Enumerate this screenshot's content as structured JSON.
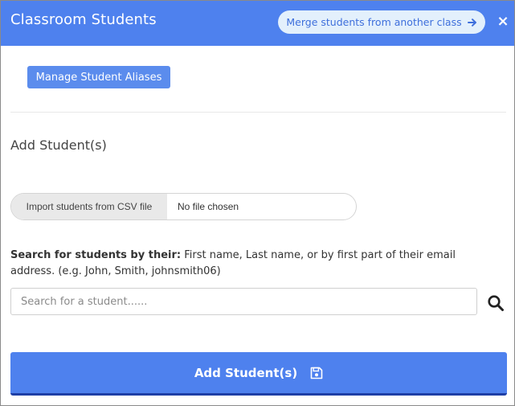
{
  "header": {
    "title": "Classroom Students",
    "merge_label": "Merge students from another class",
    "close_glyph": "×"
  },
  "aliases": {
    "button_label": "Manage Student Aliases"
  },
  "add_section": {
    "title": "Add Student(s)",
    "file_button_label": "Import students from CSV file",
    "file_status": "No file chosen",
    "search_prefix": "Search for students by their:",
    "search_hint": " First name, Last name, or by first part of their email address. (e.g. John, Smith, johnsmith06)",
    "search_placeholder": "Search for a student......",
    "search_value": "",
    "submit_label": "Add Student(s)"
  },
  "icons": {
    "merge_arrow": "arrow-right-icon",
    "close": "close-icon",
    "search": "search-icon",
    "submit": "save-icon"
  },
  "colors": {
    "header": "#4e81ee",
    "accent": "#4e81ee",
    "accent_dark": "#1f3fa6",
    "merge_pill": "#e3f0fc",
    "merge_text": "#3e6fdc",
    "alias_button": "#5b8ced"
  }
}
